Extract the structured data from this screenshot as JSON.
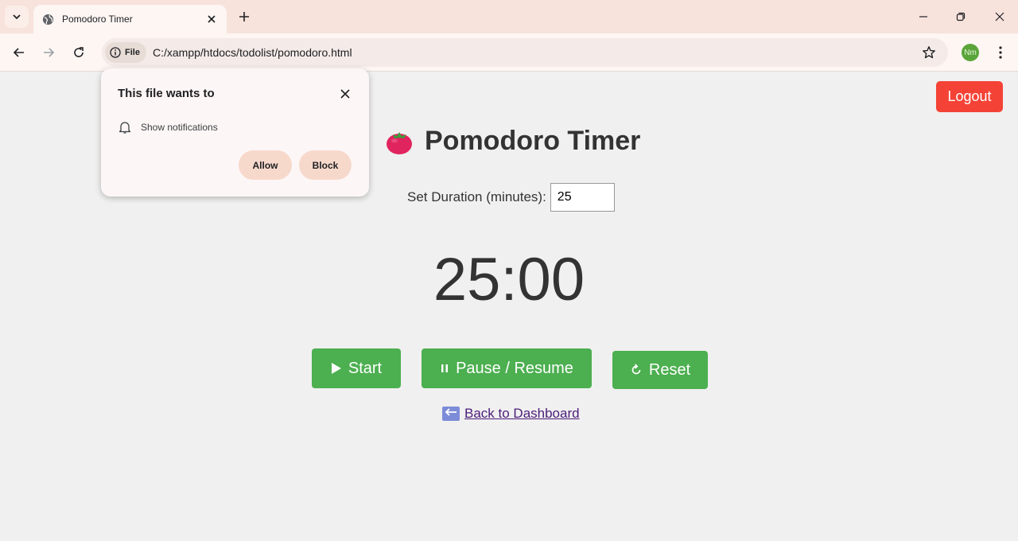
{
  "browser": {
    "tab_title": "Pomodoro Timer",
    "site_chip": "File",
    "url": "C:/xampp/htdocs/todolist/pomodoro.html",
    "profile_initials": "Nm"
  },
  "popup": {
    "title": "This file wants to",
    "permission": "Show notifications",
    "allow_label": "Allow",
    "block_label": "Block"
  },
  "page": {
    "logout_label": "Logout",
    "heading": "Pomodoro Timer",
    "duration_label": "Set Duration (minutes):",
    "duration_value": "25",
    "timer_display": "25:00",
    "start_label": "Start",
    "pause_label": "Pause / Resume",
    "reset_label": "Reset",
    "back_link": "Back to Dashboard"
  },
  "colors": {
    "logout_red": "#f44336",
    "button_green": "#4caf50",
    "chrome_tab_strip": "#f7e3dc",
    "popup_pill": "#f7d9cc"
  }
}
